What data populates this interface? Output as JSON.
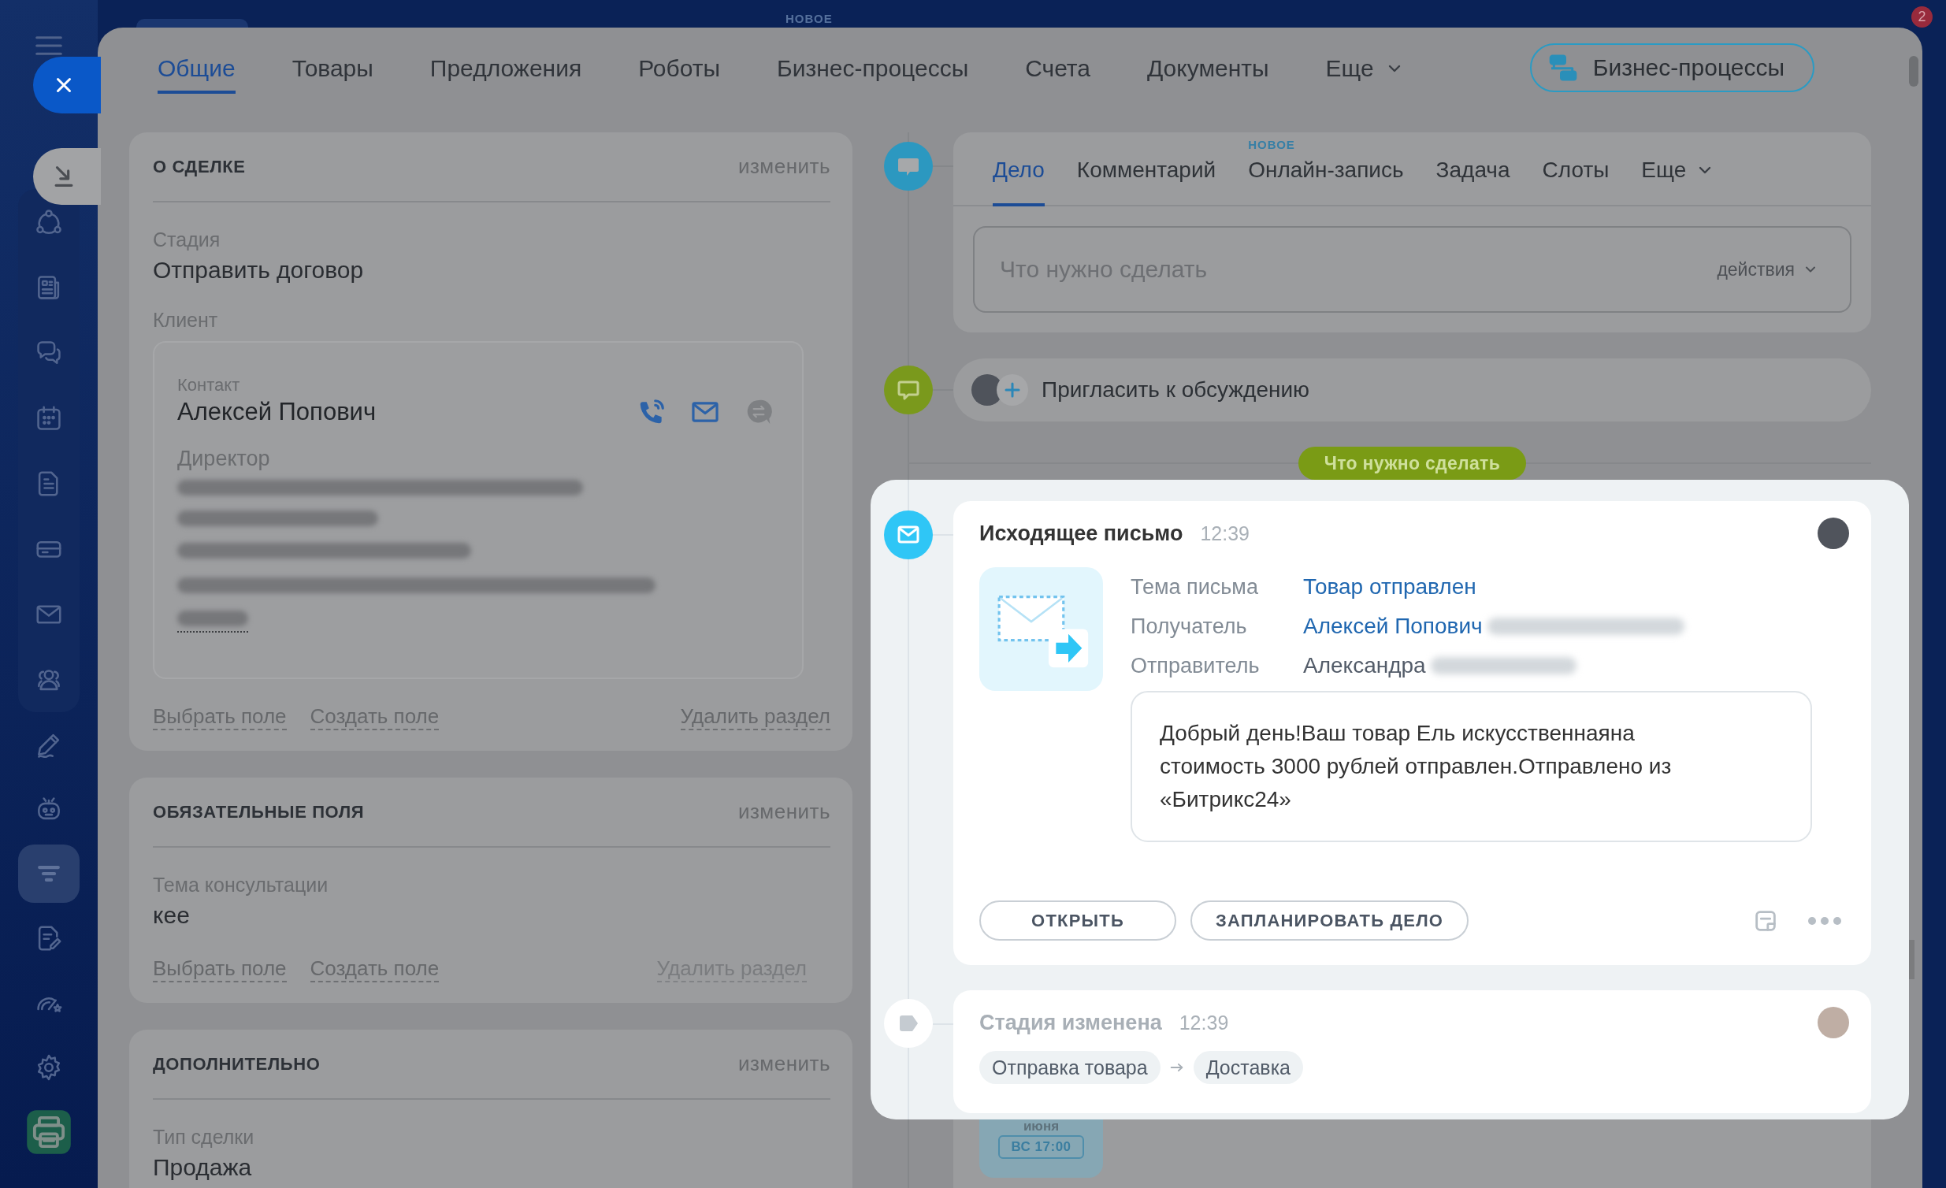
{
  "top_bar": {
    "new_label": "НОВОЕ",
    "counter": "2"
  },
  "sidebar": {
    "group": [
      {
        "selected": false
      },
      {
        "selected": false
      },
      {
        "selected": false
      },
      {
        "selected": false
      },
      {
        "selected": false
      },
      {
        "selected": false
      },
      {
        "selected": false
      },
      {
        "selected": false
      }
    ],
    "items": [
      {
        "selected": false
      },
      {
        "selected": false
      },
      {
        "selected": true
      },
      {
        "selected": false
      },
      {
        "selected": false
      },
      {
        "selected": false
      },
      {
        "selected": false
      }
    ]
  },
  "tabs": [
    {
      "label": "Общие",
      "selected": true,
      "kind": "tab"
    },
    {
      "label": "Товары",
      "selected": false,
      "kind": "tab"
    },
    {
      "label": "Предложения",
      "selected": false,
      "kind": "tab"
    },
    {
      "label": "Роботы",
      "selected": false,
      "kind": "tab"
    },
    {
      "label": "Бизнес-процессы",
      "selected": false,
      "kind": "tab"
    },
    {
      "label": "Счета",
      "selected": false,
      "kind": "tab"
    },
    {
      "label": "Документы",
      "selected": false,
      "kind": "tab"
    },
    {
      "label": "Еще",
      "selected": false,
      "kind": "dropdown"
    }
  ],
  "process_button": {
    "label": "Бизнес-процессы"
  },
  "sections": [
    {
      "title": "О СДЕЛКЕ",
      "edit": "изменить",
      "fields": [
        {
          "kind": "text",
          "label": "Стадия",
          "value": "Отправить договор"
        },
        {
          "kind": "client",
          "label": "Клиент",
          "contact": {
            "caption": "Контакт",
            "name": "Алексей Попович",
            "position": "Директор",
            "channels": [
              {
                "disabled": false
              },
              {
                "disabled": false
              },
              {
                "disabled": true
              }
            ]
          }
        }
      ],
      "links": [
        "Выбрать поле",
        "Создать поле"
      ],
      "delete": {
        "label": "Удалить раздел",
        "disabled": false
      }
    },
    {
      "title": "ОБЯЗАТЕЛЬНЫЕ ПОЛЯ",
      "edit": "изменить",
      "fields": [
        {
          "kind": "text",
          "label": "Тема консультации",
          "value": "кее"
        }
      ],
      "links": [
        "Выбрать поле",
        "Создать поле"
      ],
      "delete": {
        "label": "Удалить раздел",
        "disabled": true
      }
    },
    {
      "title": "ДОПОЛНИТЕЛЬНО",
      "edit": "изменить",
      "fields": [
        {
          "kind": "text",
          "label": "Тип сделки",
          "value": "Продажа"
        }
      ]
    }
  ],
  "composer": {
    "tabs": [
      {
        "label": "Дело",
        "selected": true,
        "kind": "tab"
      },
      {
        "label": "Комментарий",
        "selected": false,
        "kind": "tab"
      },
      {
        "label": "Онлайн-запись",
        "selected": false,
        "kind": "tab",
        "badge": "НОВОЕ"
      },
      {
        "label": "Задача",
        "selected": false,
        "kind": "tab"
      },
      {
        "label": "Слоты",
        "selected": false,
        "kind": "tab"
      },
      {
        "label": "Еще",
        "selected": false,
        "kind": "dropdown"
      }
    ],
    "placeholder": "Что нужно сделать",
    "actions": "действия"
  },
  "invite": {
    "label": "Пригласить к обсуждению"
  },
  "divider": {
    "label": "Что нужно сделать"
  },
  "feed": [
    {
      "kind": "email",
      "title": "Исходящее письмо",
      "time": "12:39",
      "fields": [
        {
          "label": "Тема письма",
          "value": "Товар отправлен",
          "link": true,
          "redacted": false
        },
        {
          "label": "Получатель",
          "value": "Алексей Попович",
          "link": true,
          "redacted": true
        },
        {
          "label": "Отправитель",
          "value": "Александра",
          "link": false,
          "redacted": true
        }
      ],
      "body": "Добрый день!Ваш товар Ель искусственнаяна стоимость 3000 рублей отправлен.Отправлено из «Битрикс24»",
      "buttons": [
        "ОТКРЫТЬ",
        "ЗАПЛАНИРОВАТЬ ДЕЛО"
      ]
    },
    {
      "kind": "stage",
      "title": "Стадия изменена",
      "time": "12:39",
      "from": "Отправка товара",
      "to": "Доставка"
    }
  ],
  "scheduled": {
    "month": "июня",
    "slot": "ВС 17:00"
  }
}
